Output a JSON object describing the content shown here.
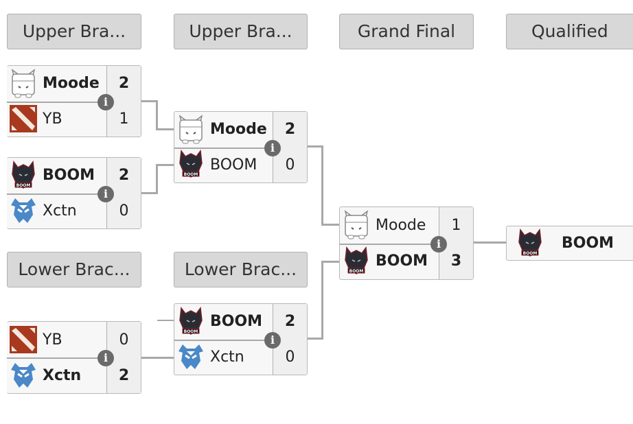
{
  "headers": {
    "upper1": "Upper Bra...",
    "upper2": "Upper Bra...",
    "grand_final": "Grand Final",
    "qualified": "Qualified",
    "lower1": "Lower Brac...",
    "lower2": "Lower Brac..."
  },
  "matches": [
    {
      "top": {
        "team": "Moode",
        "score": "2",
        "logo": "hippo-logo"
      },
      "bottom": {
        "team": "YB",
        "score": "1",
        "logo": "dota-logo"
      }
    },
    {
      "top": {
        "team": "BOOM",
        "score": "2",
        "logo": "wolf-logo"
      },
      "bottom": {
        "team": "Xctn",
        "score": "0",
        "logo": "mask-logo"
      }
    },
    {
      "top": {
        "team": "Moode",
        "score": "2",
        "logo": "hippo-logo"
      },
      "bottom": {
        "team": "BOOM",
        "score": "0",
        "logo": "wolf-logo"
      }
    },
    {
      "top": {
        "team": "Moode",
        "score": "1",
        "logo": "hippo-logo"
      },
      "bottom": {
        "team": "BOOM",
        "score": "3",
        "logo": "wolf-logo"
      }
    },
    {
      "top": {
        "team": "YB",
        "score": "0",
        "logo": "dota-logo"
      },
      "bottom": {
        "team": "Xctn",
        "score": "2",
        "logo": "mask-logo"
      }
    },
    {
      "top": {
        "team": "BOOM",
        "score": "2",
        "logo": "wolf-logo"
      },
      "bottom": {
        "team": "Xctn",
        "score": "0",
        "logo": "mask-logo"
      }
    }
  ],
  "qualified": {
    "team": "BOOM",
    "logo": "wolf-logo"
  },
  "info_glyph": "i",
  "colors": {
    "header_bg": "#d8d8d8",
    "connector": "#a8a8a8",
    "info_bg": "#6a6a6a"
  }
}
